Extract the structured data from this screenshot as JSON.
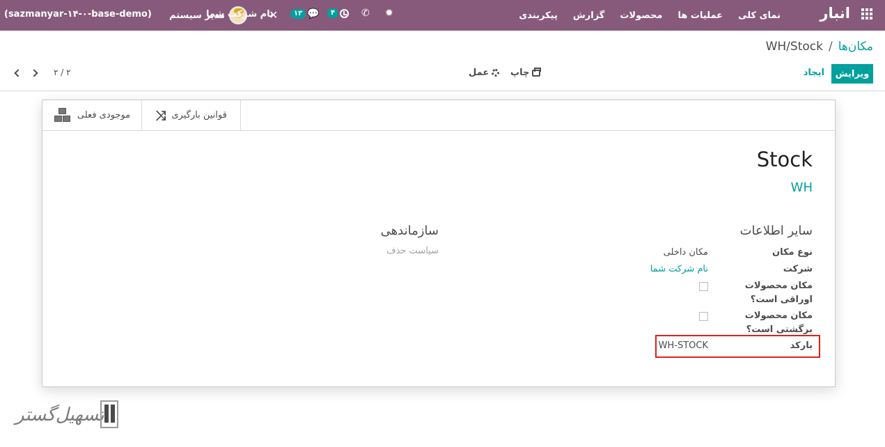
{
  "navbar": {
    "app_name": "انبار",
    "menu": [
      "نمای کلی",
      "عملیات ها",
      "محصولات",
      "گزارش",
      "پیکربندی"
    ],
    "database": "(sazmanyar-۱۴-۰-base-demo)",
    "user_name": "مدیر سیستم",
    "company": "نام شرکت شما",
    "messages_count": "۱۳",
    "activities_count": "۴",
    "colors": {
      "navbar": "#875a7b",
      "accent": "#00a09d"
    }
  },
  "breadcrumb": {
    "parent": "مکان‌ها",
    "separator": "/",
    "current": "WH/Stock"
  },
  "toolbar": {
    "edit_label": "ویرایش",
    "create_label": "ایجاد",
    "print_label": "چاپ",
    "action_label": "عمل"
  },
  "pager": {
    "value": "۲ / ۲"
  },
  "smart_buttons": {
    "current_stock": "موجودی فعلی",
    "putaway_rules": "قوانین بارگیری"
  },
  "record": {
    "name": "Stock",
    "parent_location": "WH"
  },
  "groups": {
    "other_info_title": "سایر اطلاعات",
    "organization_title": "سازماندهی"
  },
  "fields": {
    "location_type_label": "نوع مکان",
    "location_type_value": "مکان داخلی",
    "company_label": "شرکت",
    "company_value": "نام شرکت شما",
    "scrap_label": "مکان محصولات اوراقی است؟",
    "scrap_checked": false,
    "return_label": "مکان محصولات برگشتی است؟",
    "return_checked": false,
    "barcode_label": "بارکد",
    "barcode_value": "WH-STOCK",
    "removal_placeholder": "سیاست حذف"
  },
  "watermark": {
    "text": "تسهیل‌گستر"
  }
}
